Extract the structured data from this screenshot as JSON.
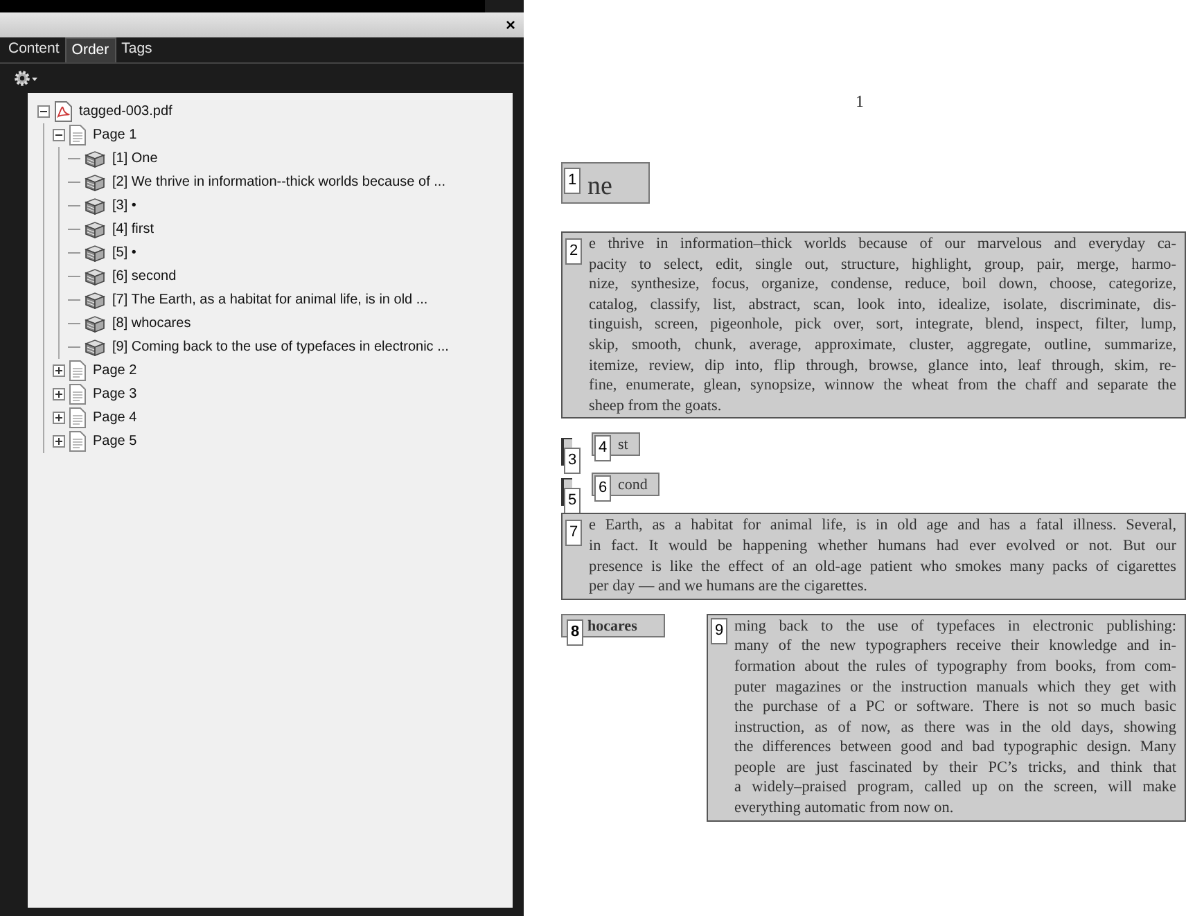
{
  "panel": {
    "close": "×",
    "tabs": [
      {
        "label": "Content",
        "selected": false
      },
      {
        "label": "Order",
        "selected": true
      },
      {
        "label": "Tags",
        "selected": false
      }
    ],
    "tree": {
      "label": "tagged-003.pdf",
      "kind": "file",
      "expanded": true,
      "children": [
        {
          "label": "Page 1",
          "kind": "page",
          "expanded": true,
          "children": [
            {
              "label": "[1] One",
              "kind": "item"
            },
            {
              "label": "[2] We thrive in information--thick worlds because of ...",
              "kind": "item"
            },
            {
              "label": "[3] •",
              "kind": "item"
            },
            {
              "label": "[4] first",
              "kind": "item"
            },
            {
              "label": "[5] •",
              "kind": "item"
            },
            {
              "label": "[6] second",
              "kind": "item"
            },
            {
              "label": "[7] The Earth, as a habitat for animal life, is in old ...",
              "kind": "item"
            },
            {
              "label": "[8] whocares",
              "kind": "item"
            },
            {
              "label": "[9] Coming back to the use of typefaces in electronic ...",
              "kind": "item"
            }
          ]
        },
        {
          "label": "Page 2",
          "kind": "page",
          "expanded": false
        },
        {
          "label": "Page 3",
          "kind": "page",
          "expanded": false
        },
        {
          "label": "Page 4",
          "kind": "page",
          "expanded": false
        },
        {
          "label": "Page 5",
          "kind": "page",
          "expanded": false
        }
      ]
    }
  },
  "document": {
    "page_number": "1",
    "rows": [
      [
        {
          "kind": "heading",
          "badge": "1",
          "text": "ne"
        }
      ],
      [
        {
          "kind": "paragraph",
          "badge": "2",
          "lines": [
            "e thrive in information–thick worlds because of our marvelous and everyday ca-",
            "pacity to select, edit, single out, structure, highlight, group, pair, merge, harmo-",
            "nize, synthesize, focus, organize, condense, reduce, boil down, choose, categorize,",
            "catalog, classify, list, abstract, scan, look into, idealize, isolate, discriminate, dis-",
            "tinguish, screen, pigeonhole, pick over, sort, integrate, blend, inspect, filter, lump,",
            "skip, smooth, chunk, average, approximate, cluster, aggregate, outline, summarize,",
            "itemize, review, dip into, flip through, browse, glance into, leaf through, skim, re-",
            "fine, enumerate, glean, synopsize, winnow the wheat from the chaff and separate the",
            "sheep from the goats."
          ]
        }
      ],
      [
        {
          "kind": "bullet",
          "badge": "3"
        },
        {
          "kind": "label",
          "badge": "4",
          "text": "st"
        }
      ],
      [
        {
          "kind": "bullet",
          "badge": "5"
        },
        {
          "kind": "label",
          "badge": "6",
          "text": "cond"
        }
      ],
      [
        {
          "kind": "paragraph",
          "badge": "7",
          "lines": [
            "e Earth, as a habitat for animal life, is in old age and has a fatal illness. Several,",
            "in fact. It would be happening whether humans had ever evolved or not. But our",
            "presence is like the effect of an old-age patient who smokes many packs of cigarettes",
            "per day — and we humans are the cigarettes."
          ]
        }
      ],
      [
        {
          "kind": "bold",
          "badge": "8",
          "text": "hocares"
        },
        {
          "kind": "column",
          "badge": "9",
          "lines": [
            "ming back to the use of typefaces in electronic publishing:",
            "many of the new typographers receive their knowledge and in-",
            "formation about the rules of typography from books, from com-",
            "puter magazines or the instruction manuals which they get with",
            "the purchase of a PC or software. There is not so much basic",
            "instruction, as of now, as there was in the old days, showing",
            "the differences between good and bad typographic design. Many",
            "people are just fascinated by their PC’s tricks, and think that",
            "a widely–praised program, called up on the screen, will make",
            "everything automatic from now on."
          ]
        }
      ]
    ]
  }
}
